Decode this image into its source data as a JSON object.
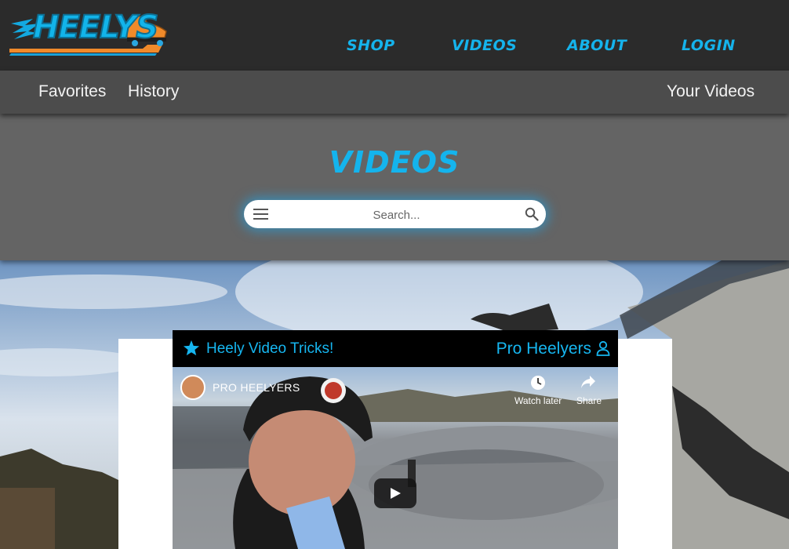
{
  "logo": {
    "text": "HEELYS"
  },
  "nav": {
    "shop": "SHOP",
    "videos": "VIDEOS",
    "about": "ABOUT",
    "login": "LOGIN"
  },
  "subnav": {
    "favorites": "Favorites",
    "history": "History",
    "your_videos": "Your Videos"
  },
  "page": {
    "title": "VIDEOS"
  },
  "search": {
    "placeholder": "Search..."
  },
  "video": {
    "title": "Heely Video Tricks!",
    "channel_header": "Pro Heelyers",
    "player": {
      "channel_name": "PRO HEELYERS",
      "watch_later": "Watch later",
      "share": "Share"
    }
  },
  "colors": {
    "accent": "#15b3ec",
    "logo_orange": "#f08a2a",
    "topbar": "#2b2b2b",
    "subbar": "#4c4c4c",
    "hero": "#646464"
  },
  "icons": [
    "menu-icon",
    "search-icon",
    "star-icon",
    "user-icon",
    "clock-icon",
    "share-icon",
    "play-icon"
  ]
}
